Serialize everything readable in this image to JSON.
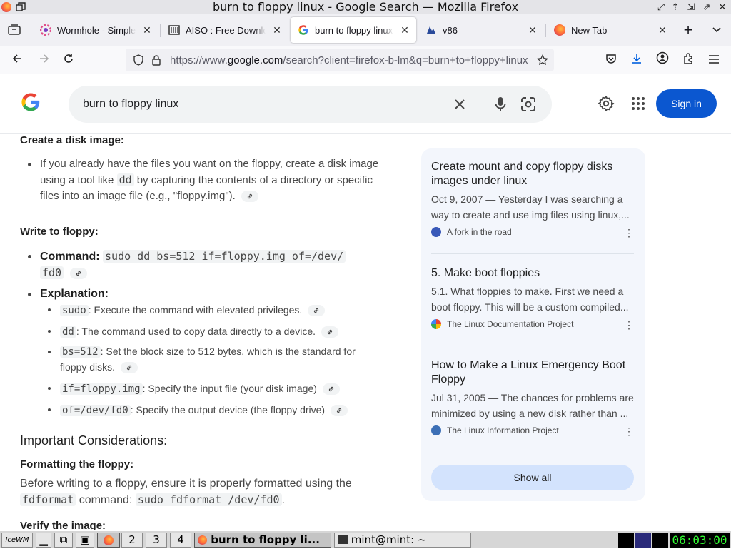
{
  "window": {
    "title": "burn to floppy linux - Google Search — Mozilla Firefox"
  },
  "tabs": [
    {
      "label": "Wormhole - Simple Private File Sharing",
      "icon": "wormhole-icon"
    },
    {
      "label": "AISO : Free Download",
      "icon": "archive-icon"
    },
    {
      "label": "burn to floppy linux",
      "icon": "google-icon",
      "active": true
    },
    {
      "label": "v86",
      "icon": "v86-icon"
    },
    {
      "label": "New Tab",
      "icon": "firefox-icon"
    }
  ],
  "nav": {
    "url_prefix": "https://www.",
    "url_domain": "google.com",
    "url_rest": "/search?client=firefox-b-lm&q=burn+to+floppy+linux"
  },
  "search": {
    "query": "burn to floppy linux",
    "signin_label": "Sign in"
  },
  "content": {
    "create_heading": "Create a disk image:",
    "create_text_1": "If you already have the files you want on the floppy, create a disk image using a tool like ",
    "create_code": "dd",
    "create_text_2": " by capturing the contents of a directory or specific files into an image file (e.g., \"floppy.img\").",
    "write_heading": "Write to floppy:",
    "command_label": "Command:",
    "command_code_1": "sudo dd bs=512 if=floppy.img of=/dev/",
    "command_code_2": "fd0",
    "explanation_label": "Explanation:",
    "explanations": [
      {
        "code": "sudo",
        "text": ": Execute the command with elevated privileges."
      },
      {
        "code": "dd",
        "text": ": The command used to copy data directly to a device."
      },
      {
        "code": "bs=512",
        "text": ": Set the block size to 512 bytes, which is the standard for",
        "text2": "floppy disks."
      },
      {
        "code": "if=floppy.img",
        "text": ": Specify the input file (your disk image)"
      },
      {
        "code": "of=/dev/fd0",
        "text": ": Specify the output device (the floppy drive)"
      }
    ],
    "important_heading": "Important Considerations:",
    "format_heading": "Formatting the floppy:",
    "format_text": "Before writing to a floppy, ensure it is properly formatted using the",
    "format_code_1": "fdformat",
    "format_text_2": " command: ",
    "format_code_2": "sudo fdformat /dev/fd0",
    "format_text_3": ".",
    "verify_heading": "Verify the image:"
  },
  "results": [
    {
      "title_1": "Create mount and copy floppy disks",
      "title_2": "images under linux",
      "snippet_1": "Oct 9, 2007 — Yesterday I was searching a",
      "snippet_2": "way to create and use img files using linux,...",
      "source": "A fork in the road"
    },
    {
      "title_1": "5. Make boot floppies",
      "title_2": "",
      "snippet_1": "5.1. What floppies to make. First we need a",
      "snippet_2": "boot floppy. This will be a custom compiled...",
      "source": "The Linux Documentation Project"
    },
    {
      "title_1": "How to Make a Linux Emergency Boot",
      "title_2": "Floppy",
      "snippet_1": "Jul 31, 2005 — The chances for problems are",
      "snippet_2": "minimized by using a new disk rather than ...",
      "source": "The Linux Information Project"
    }
  ],
  "show_all_label": "Show all",
  "taskbar": {
    "workspaces": [
      "2",
      "3",
      "4"
    ],
    "firefox_task": "burn to floppy li...",
    "terminal_task": "mint@mint: ~",
    "clock": "06:03:00"
  }
}
